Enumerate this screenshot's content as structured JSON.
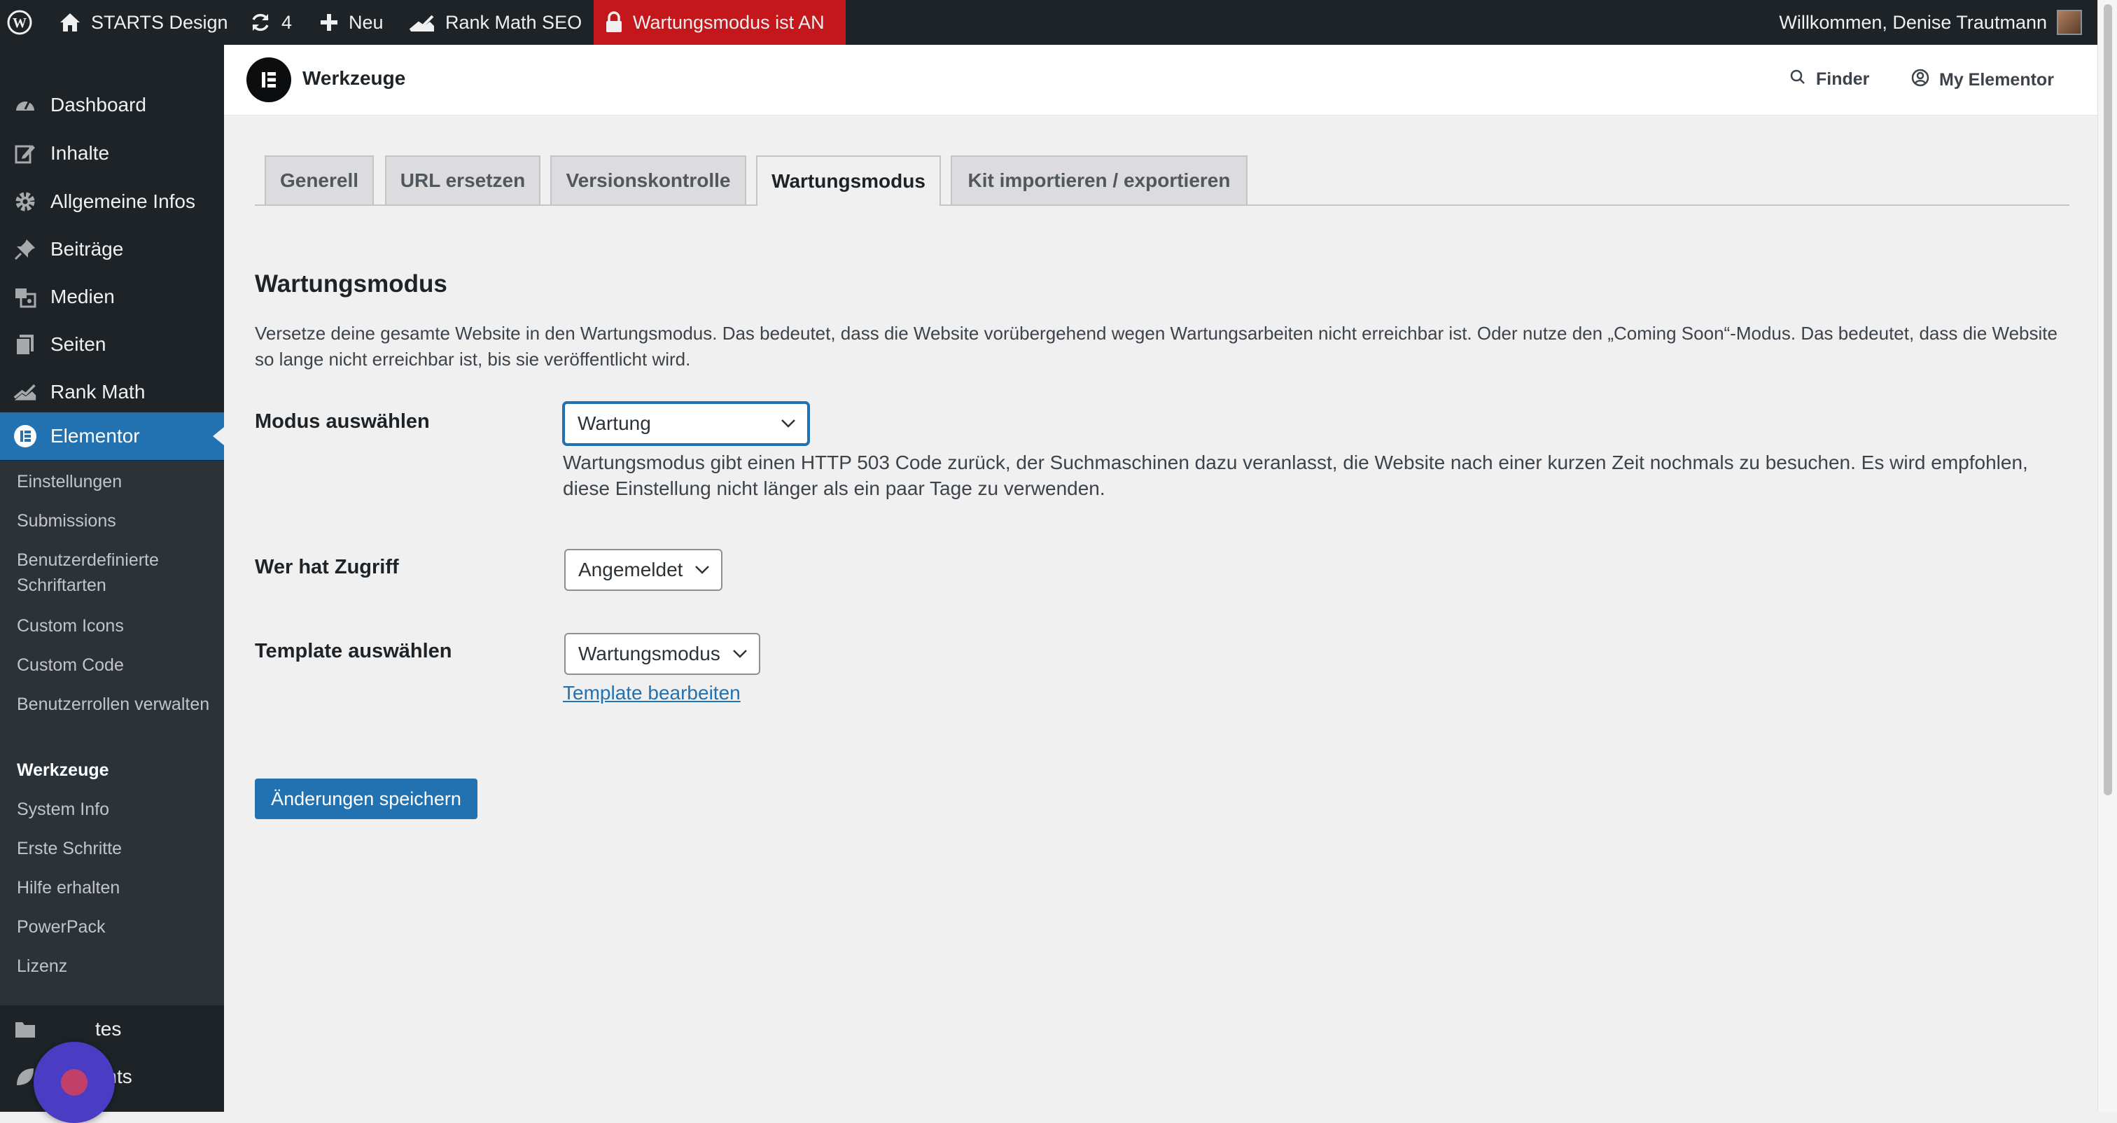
{
  "admin_bar": {
    "site_name": "STARTS Design",
    "updates_count": "4",
    "new_label": "Neu",
    "rankmath_label": "Rank Math SEO",
    "maintenance_label": "Wartungsmodus ist AN",
    "account_label": "Willkommen, Denise Trautmann"
  },
  "sidebar": {
    "items": [
      {
        "label": "Dashboard",
        "icon": "dashboard-icon"
      },
      {
        "label": "Inhalte",
        "icon": "edit-icon"
      },
      {
        "label": "Allgemeine Infos",
        "icon": "gear-icon"
      },
      {
        "label": "Beiträge",
        "icon": "pin-icon"
      },
      {
        "label": "Medien",
        "icon": "media-icon"
      },
      {
        "label": "Seiten",
        "icon": "pages-icon"
      },
      {
        "label": "Rank Math",
        "icon": "rankmath-icon"
      },
      {
        "label": "Elementor",
        "icon": "elementor-icon"
      }
    ],
    "submenu": [
      "Einstellungen",
      "Submissions",
      "Benutzerdefinierte Schriftarten",
      "Custom Icons",
      "Custom Code",
      "Benutzerrollen verwalten",
      "Werkzeuge",
      "System Info",
      "Erste Schritte",
      "Hilfe erhalten",
      "PowerPack",
      "Lizenz"
    ],
    "bottom_items": [
      {
        "label": "tes",
        "icon": "folder-icon"
      },
      {
        "label": "Elements",
        "icon": "leaf-icon"
      }
    ]
  },
  "header": {
    "title": "Werkzeuge",
    "finder_label": "Finder",
    "my_elementor_label": "My Elementor"
  },
  "tabs": [
    {
      "label": "Generell"
    },
    {
      "label": "URL ersetzen"
    },
    {
      "label": "Versionskontrolle"
    },
    {
      "label": "Wartungsmodus"
    },
    {
      "label": "Kit importieren / exportieren"
    }
  ],
  "main": {
    "section_title": "Wartungsmodus",
    "section_description": "Versetze deine gesamte Website in den Wartungsmodus. Das bedeutet, dass die Website vorübergehend wegen Wartungsarbeiten nicht erreichbar ist. Oder nutze den „Coming Soon“-Modus. Das bedeutet, dass die Website so lange nicht erreichbar ist, bis sie veröffentlicht wird.",
    "mode": {
      "label": "Modus auswählen",
      "value": "Wartung",
      "help": "Wartungsmodus gibt einen HTTP 503 Code zurück, der Suchmaschinen dazu veranlasst, die Website nach einer kurzen Zeit nochmals zu besuchen. Es wird empfohlen, diese Einstellung nicht länger als ein paar Tage zu verwenden."
    },
    "access": {
      "label": "Wer hat Zugriff",
      "value": "Angemeldet"
    },
    "template": {
      "label": "Template auswählen",
      "value": "Wartungsmodus",
      "edit_link": "Template bearbeiten"
    },
    "save_label": "Änderungen speichern"
  },
  "colors": {
    "admin_bar_bg": "#1d2327",
    "maintenance_bg": "#c4171b",
    "accent": "#2271b1"
  }
}
